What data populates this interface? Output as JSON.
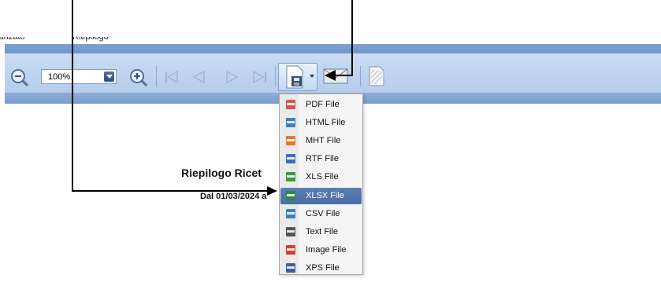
{
  "tabs": [
    "Avanzato",
    "Riepilogo"
  ],
  "toolbar": {
    "zoom_value": "100%",
    "icons": [
      "zoom-out-icon",
      "zoom-in-icon",
      "first-page-icon",
      "previous-page-icon",
      "next-page-icon",
      "last-page-icon",
      "export-icon",
      "email-icon",
      "watermark-icon"
    ]
  },
  "export_menu": {
    "items": [
      {
        "label": "PDF File",
        "color": "#d9534f"
      },
      {
        "label": "HTML File",
        "color": "#3d7fc4"
      },
      {
        "label": "MHT File",
        "color": "#e07a2e"
      },
      {
        "label": "RTF File",
        "color": "#3d6fb5"
      },
      {
        "label": "XLS File",
        "color": "#3a9a3a"
      },
      {
        "label": "XLSX File",
        "color": "#2f8a3a"
      },
      {
        "label": "CSV File",
        "color": "#3d7fc4"
      },
      {
        "label": "Text File",
        "color": "#555555"
      },
      {
        "label": "Image File",
        "color": "#cc4433"
      },
      {
        "label": "XPS File",
        "color": "#3d5f95"
      }
    ],
    "highlighted": "XLSX File"
  },
  "document": {
    "title": "Riepilogo Ricet",
    "subtitle": "Dal 01/03/2024 a"
  }
}
